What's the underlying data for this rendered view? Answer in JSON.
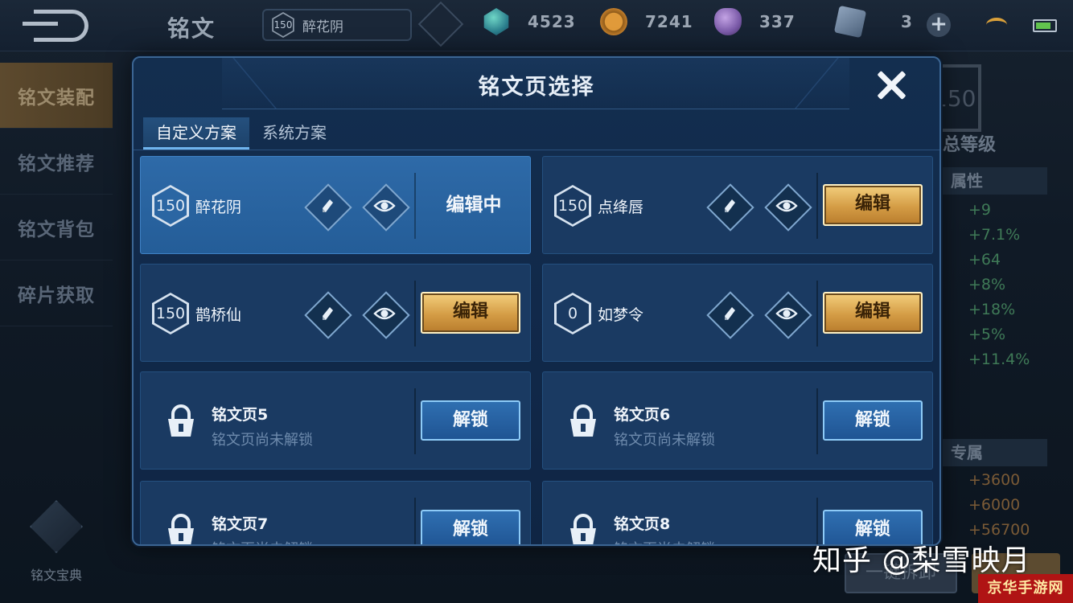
{
  "topbar": {
    "title": "铭文",
    "current_page_level": "150",
    "current_page_name": "醉花阴",
    "resources": [
      {
        "icon": "crystal-icon",
        "value": "4523"
      },
      {
        "icon": "coin-icon",
        "value": "7241"
      },
      {
        "icon": "gem-icon",
        "value": "337"
      },
      {
        "icon": "card-icon",
        "value": "3"
      }
    ]
  },
  "sidebar": {
    "items": [
      {
        "label": "铭文装配",
        "active": true
      },
      {
        "label": "铭文推荐",
        "active": false
      },
      {
        "label": "铭文背包",
        "active": false
      },
      {
        "label": "碎片获取",
        "active": false
      }
    ],
    "codex_label": "铭文宝典"
  },
  "right_panel": {
    "level": "150",
    "level_label": "总等级",
    "attr_header": "属性",
    "stats": [
      "+9",
      "+7.1%",
      "+64",
      "+8%",
      "+18%",
      "+5%",
      "+11.4%"
    ],
    "exclusive_header": "专属",
    "exclusive_stats": [
      "+3600",
      "+6000",
      "+56700"
    ],
    "disassemble_label": "一键拆卸"
  },
  "modal": {
    "title": "铭文页选择",
    "tabs": [
      {
        "label": "自定义方案",
        "active": true
      },
      {
        "label": "系统方案",
        "active": false
      }
    ],
    "editing_label": "编辑中",
    "edit_label": "编辑",
    "unlock_label": "解锁",
    "locked_subtitle": "铭文页尚未解锁",
    "slots": [
      {
        "level": "150",
        "name": "醉花阴",
        "state": "editing"
      },
      {
        "level": "150",
        "name": "点绛唇",
        "state": "edit"
      },
      {
        "level": "150",
        "name": "鹊桥仙",
        "state": "edit"
      },
      {
        "level": "0",
        "name": "如梦令",
        "state": "edit"
      },
      {
        "name": "铭文页5",
        "state": "locked"
      },
      {
        "name": "铭文页6",
        "state": "locked"
      },
      {
        "name": "铭文页7",
        "state": "locked"
      },
      {
        "name": "铭文页8",
        "state": "locked"
      }
    ]
  },
  "watermark": "知乎 @梨雪映月",
  "corner_badge": "京华手游网",
  "colors": {
    "modal_bg": "#11294a",
    "current_slot": "#2e6aa8",
    "gold_button": "#d49c45",
    "blue_button": "#1f5493"
  }
}
